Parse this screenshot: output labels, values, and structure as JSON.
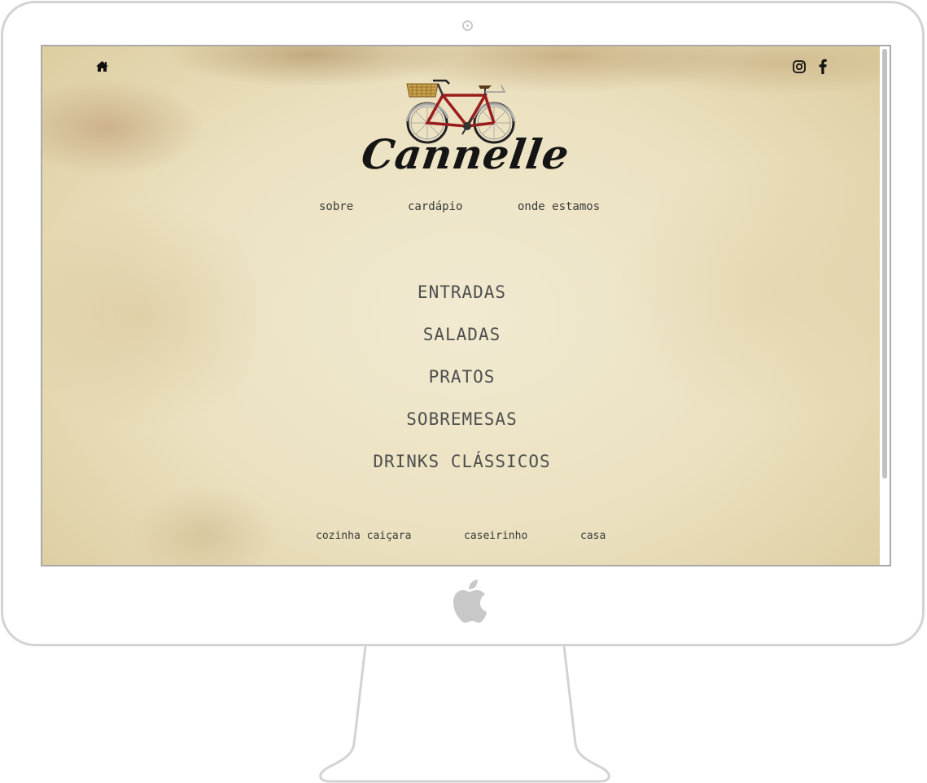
{
  "site": {
    "brand": "Cannelle",
    "nav": [
      {
        "label": "sobre"
      },
      {
        "label": "cardápio"
      },
      {
        "label": "onde estamos"
      }
    ],
    "menu": [
      {
        "label": "ENTRADAS"
      },
      {
        "label": "SALADAS"
      },
      {
        "label": "PRATOS"
      },
      {
        "label": "SOBREMESAS"
      },
      {
        "label": "DRINKS CLÁSSICOS"
      }
    ],
    "footer_nav": [
      {
        "label": "cozinha caiçara"
      },
      {
        "label": "caseirinho"
      },
      {
        "label": "casa"
      }
    ]
  },
  "icons": {
    "home": "home-icon",
    "instagram": "instagram-icon",
    "facebook": "facebook-icon",
    "logo": "bicycle-logo",
    "device": "apple-logo"
  },
  "colors": {
    "paper": "#ebe1c0",
    "text": "#4e4e4e",
    "bike_frame": "#9b1c1c",
    "frame_border": "#d3d3d3"
  }
}
